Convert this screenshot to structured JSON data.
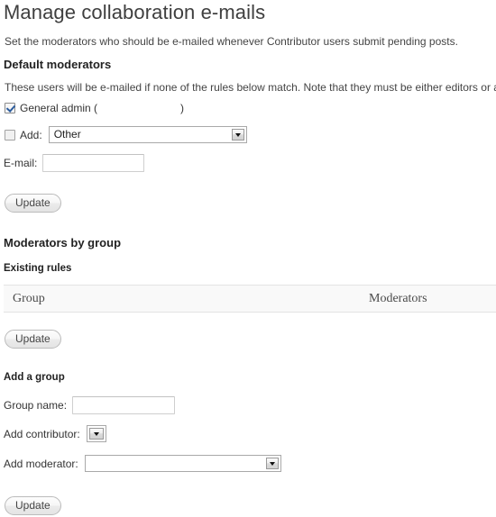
{
  "page": {
    "title": "Manage collaboration e-mails",
    "intro": "Set the moderators who should be e-mailed whenever Contributor users submit pending posts."
  },
  "default_moderators": {
    "heading": "Default moderators",
    "description": "These users will be e-mailed if none of the rules below match. Note that they must be either editors or administrators.",
    "general_admin": {
      "label": "General admin (",
      "label_close": ")",
      "checked": true
    },
    "add_row": {
      "label": "Add:",
      "checked": false,
      "select_value": "Other"
    },
    "email_row": {
      "label": "E-mail:",
      "value": "",
      "placeholder": ""
    },
    "update_label": "Update"
  },
  "moderators_by_group": {
    "heading": "Moderators by group",
    "existing_rules_heading": "Existing rules",
    "table": {
      "columns": [
        "Group",
        "Moderators"
      ],
      "rows": []
    },
    "update_label": "Update"
  },
  "add_group": {
    "heading": "Add a group",
    "group_name": {
      "label": "Group name:",
      "value": "",
      "placeholder": ""
    },
    "add_contributor": {
      "label": "Add contributor:",
      "select_value": ""
    },
    "add_moderator": {
      "label": "Add moderator:",
      "select_value": ""
    },
    "update_label": "Update"
  },
  "colors": {
    "accent": "#2b5c9e",
    "text": "#333333",
    "table_header_bg": "#f9f9f9",
    "border": "#e3e3e3"
  }
}
